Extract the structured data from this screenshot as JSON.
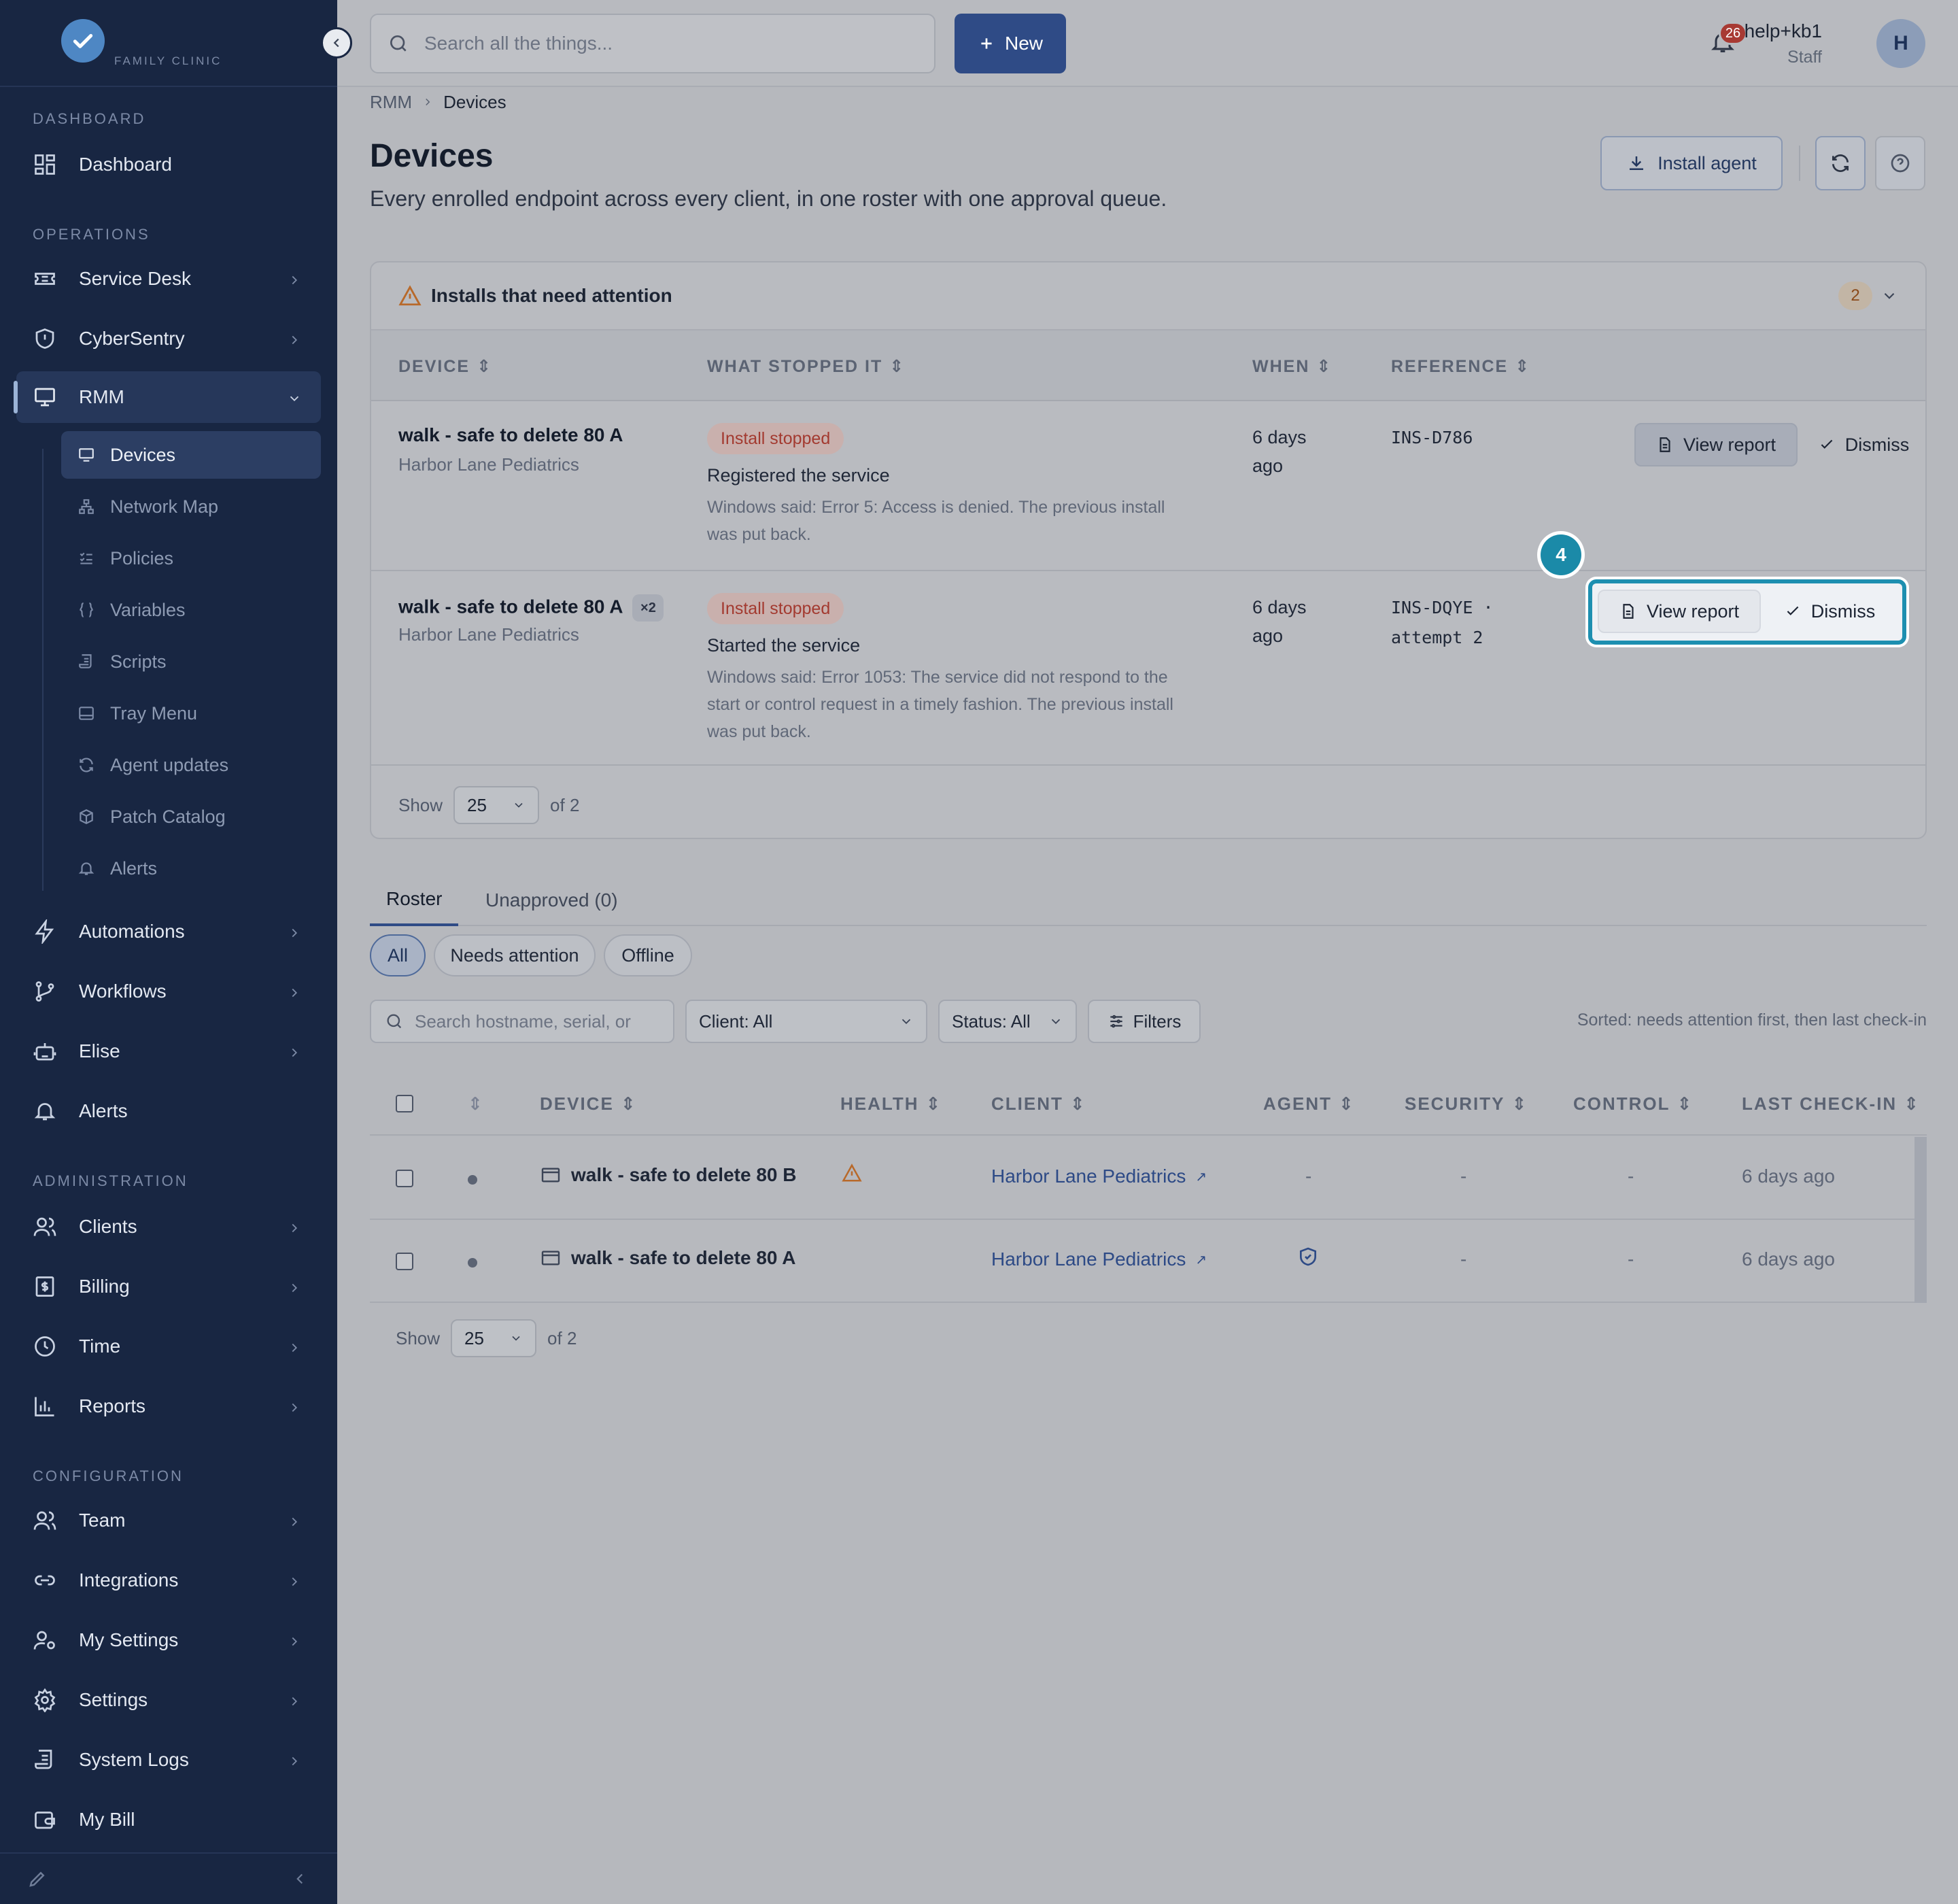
{
  "brand": {
    "logo_text": "FAMILY CLINIC"
  },
  "sidebar": {
    "sections": {
      "dashboard": "DASHBOARD",
      "operations": "OPERATIONS",
      "administration": "ADMINISTRATION",
      "configuration": "CONFIGURATION"
    },
    "items": {
      "dashboard": "Dashboard",
      "service_desk": "Service Desk",
      "cybersentry": "CyberSentry",
      "rmm": "RMM",
      "automations": "Automations",
      "workflows": "Workflows",
      "elise": "Elise",
      "alerts": "Alerts",
      "clients": "Clients",
      "billing": "Billing",
      "time": "Time",
      "reports": "Reports",
      "team": "Team",
      "integrations": "Integrations",
      "my_settings": "My Settings",
      "settings": "Settings",
      "system_logs": "System Logs",
      "my_bill": "My Bill"
    },
    "rmm_sub": {
      "devices": "Devices",
      "network_map": "Network Map",
      "policies": "Policies",
      "variables": "Variables",
      "scripts": "Scripts",
      "tray_menu": "Tray Menu",
      "agent_updates": "Agent updates",
      "patch_catalog": "Patch Catalog",
      "alerts": "Alerts"
    }
  },
  "topbar": {
    "search_placeholder": "Search all the things...",
    "new_label": "New",
    "notification_count": "26",
    "user_name": "help+kb1",
    "user_role": "Staff",
    "avatar_initial": "H"
  },
  "page": {
    "breadcrumb": [
      "RMM",
      "Devices"
    ],
    "title": "Devices",
    "subtitle": "Every enrolled endpoint across every client, in one roster with one approval queue.",
    "install_agent_label": "Install agent"
  },
  "attention": {
    "title": "Installs that need attention",
    "count": "2",
    "columns": {
      "device": "DEVICE",
      "what": "WHAT STOPPED IT",
      "when": "WHEN",
      "reference": "REFERENCE"
    },
    "rows": [
      {
        "device": "walk - safe to delete 80 A",
        "client": "Harbor Lane Pediatrics",
        "status": "Install stopped",
        "step": "Registered the service",
        "detail": "Windows said: Error 5: Access is denied. The previous install was put back.",
        "when": "6 days ago",
        "reference": "INS-D786",
        "view": "View report",
        "dismiss": "Dismiss"
      },
      {
        "device": "walk - safe to delete 80 A",
        "multiplier": "×2",
        "client": "Harbor Lane Pediatrics",
        "status": "Install stopped",
        "step": "Started the service",
        "detail": "Windows said: Error 1053: The service did not respond to the start or control request in a timely fashion. The previous install was put back.",
        "when": "6 days ago",
        "reference": "INS-DQYE · attempt 2",
        "view": "View report",
        "dismiss": "Dismiss"
      }
    ],
    "show_label": "Show",
    "page_size": "25",
    "of_label": "of 2"
  },
  "callout": {
    "step": "4"
  },
  "tabs": {
    "roster": "Roster",
    "unapproved": "Unapproved (0)"
  },
  "chips": {
    "all": "All",
    "needs_attention": "Needs attention",
    "offline": "Offline"
  },
  "filters": {
    "search_placeholder": "Search hostname, serial, or",
    "client": "Client: All",
    "status": "Status: All",
    "filters_label": "Filters",
    "sorted_note": "Sorted: needs attention first, then last check-in"
  },
  "roster": {
    "columns": {
      "device": "DEVICE",
      "health": "HEALTH",
      "client": "CLIENT",
      "agent": "AGENT",
      "security": "SECURITY",
      "control": "CONTROL",
      "last_checkin": "LAST CHECK-IN"
    },
    "rows": [
      {
        "device": "walk - safe to delete 80 B",
        "client": "Harbor Lane Pediatrics",
        "agent": "-",
        "security": "-",
        "control": "-",
        "last_checkin": "6 days ago"
      },
      {
        "device": "walk - safe to delete 80 A",
        "client": "Harbor Lane Pediatrics",
        "agent": "",
        "security": "-",
        "control": "-",
        "last_checkin": "6 days ago"
      }
    ],
    "show_label": "Show",
    "page_size": "25",
    "of_label": "of 2"
  },
  "colors": {
    "sidebar": "#182642",
    "accent": "#2f4b86",
    "highlight": "#1d8fb0",
    "danger": "#a33a30"
  }
}
